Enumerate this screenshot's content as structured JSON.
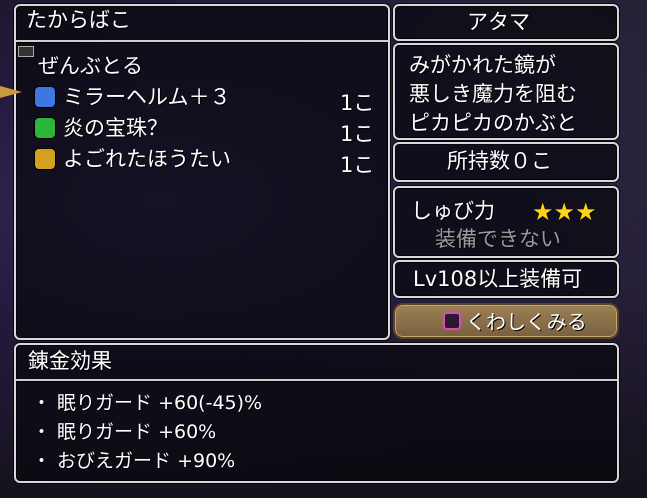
{
  "chest_panel": {
    "title": "たからばこ",
    "take_all": "ぜんぶとる",
    "items": [
      {
        "name": "ミラーヘルム＋３",
        "qty": "1こ",
        "icon": "helmet-icon",
        "color": "#3c78e0"
      },
      {
        "name": "炎の宝珠？",
        "qty": "1こ",
        "icon": "orb-icon",
        "color": "#2fb43a"
      },
      {
        "name": "よごれたほうたい",
        "qty": "1こ",
        "icon": "bandage-icon",
        "color": "#d4a020"
      }
    ]
  },
  "category_panel": {
    "label": "アタマ"
  },
  "description_panel": {
    "lines": [
      "みがかれた鏡が",
      "悪しき魔力を阻む",
      "ピカピカのかぶと"
    ]
  },
  "owned_panel": {
    "label": "所持数０こ"
  },
  "defense_panel": {
    "label": "しゅび力",
    "stars": "★★★",
    "status": "装備できない"
  },
  "level_panel": {
    "label": "Lv108以上装備可"
  },
  "details_button": {
    "label": "くわしくみる",
    "icon": "square-button-icon"
  },
  "alchemy_panel": {
    "title": "錬金効果",
    "effects": [
      "・ 眠りガード +60(-45)%",
      "・ 眠りガード +60%",
      "・ おびえガード +90%"
    ]
  },
  "colors": {
    "accent_star": "#ffd21a",
    "panel_border": "#d8d8d8",
    "button_bg": "#8a6e48"
  }
}
